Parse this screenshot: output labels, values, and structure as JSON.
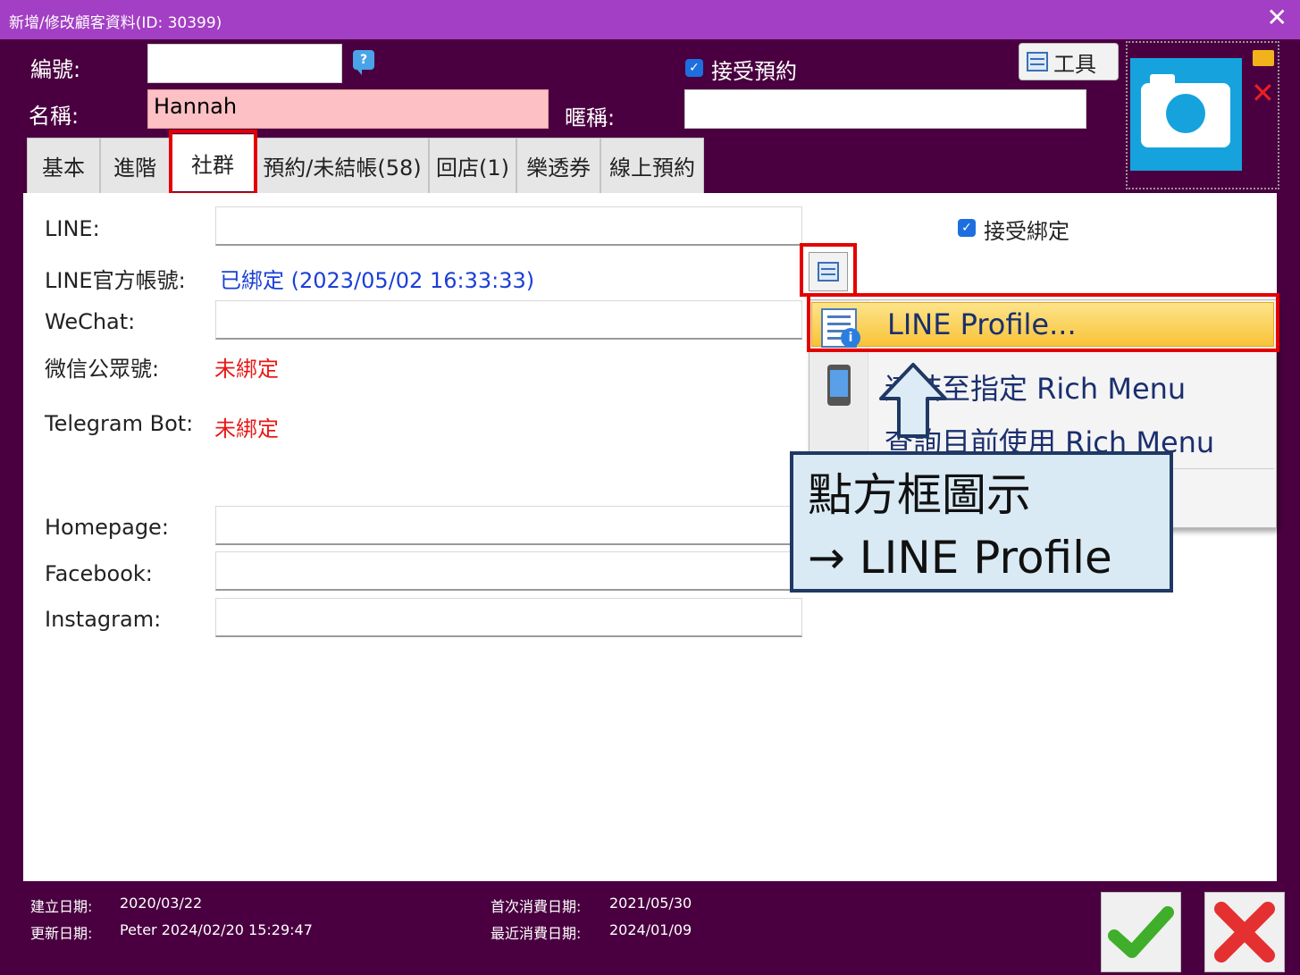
{
  "window": {
    "title": "新增/修改顧客資料(ID: 30399)",
    "close_glyph": "✕"
  },
  "header": {
    "code_label": "編號:",
    "code_value": "",
    "help_glyph": "?",
    "accept_booking_label": "接受預約",
    "name_label": "名稱:",
    "name_value": "Hannah",
    "nickname_label": "暱稱:",
    "nickname_value": "",
    "tool_label": "工具"
  },
  "tabs": [
    {
      "label": "基本"
    },
    {
      "label": "進階"
    },
    {
      "label": "社群"
    },
    {
      "label": "預約/未結帳(58)"
    },
    {
      "label": "回店(1)"
    },
    {
      "label": "樂透券"
    },
    {
      "label": "線上預約"
    }
  ],
  "social": {
    "line_label": "LINE:",
    "line_value": "",
    "line_official_label": "LINE官方帳號:",
    "line_official_status": "已綁定 (2023/05/02 16:33:33)",
    "wechat_label": "WeChat:",
    "wechat_value": "",
    "wechat_official_label": "微信公眾號:",
    "wechat_official_status": "未綁定",
    "telegram_label": "Telegram Bot:",
    "telegram_status": "未綁定",
    "homepage_label": "Homepage:",
    "homepage_value": "",
    "facebook_label": "Facebook:",
    "facebook_value": "",
    "instagram_label": "Instagram:",
    "instagram_value": "",
    "accept_binding_label": "接受綁定"
  },
  "context_menu": {
    "items": [
      {
        "label": "LINE Profile..."
      },
      {
        "label": "連結至指定 Rich Menu"
      },
      {
        "label": "查詢目前使用 Rich Menu"
      }
    ],
    "info_glyph": "i"
  },
  "callout": {
    "line1": "點方框圖示",
    "line2": "→ LINE Profile"
  },
  "footer": {
    "created_label": "建立日期:",
    "created_value": "2020/03/22",
    "updated_label": "更新日期:",
    "updated_value": "Peter 2024/02/20 15:29:47",
    "first_purchase_label": "首次消費日期:",
    "first_purchase_value": "2021/05/30",
    "last_purchase_label": "最近消費日期:",
    "last_purchase_value": "2024/01/09"
  },
  "colors": {
    "titlebar": "#a33fc4",
    "window_bg": "#4a0040",
    "highlight_red": "#e40000",
    "bound_blue": "#1b3fd6",
    "unbound_red": "#e81818",
    "photo_blue": "#16a3dd"
  }
}
